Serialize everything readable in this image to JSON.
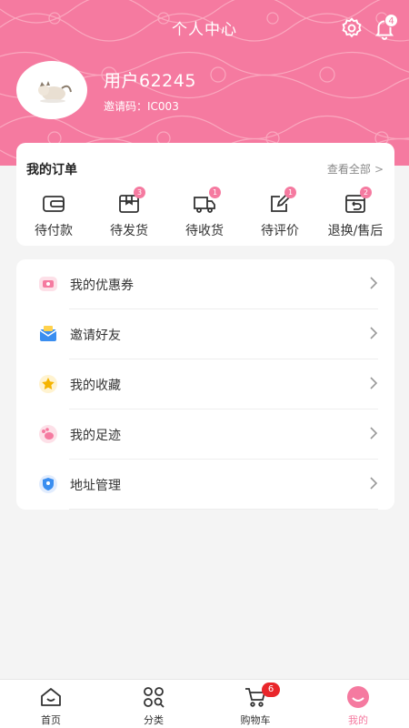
{
  "header": {
    "title": "个人中心",
    "notification_count": "4",
    "accent_color": "#f57aa0"
  },
  "profile": {
    "username": "用户62245",
    "invite_code": "邀请码：IC003"
  },
  "orders": {
    "title": "我的订单",
    "view_all": "查看全部",
    "items": [
      {
        "label": "待付款",
        "icon": "wallet-icon",
        "badge": ""
      },
      {
        "label": "待发货",
        "icon": "box-icon",
        "badge": "3"
      },
      {
        "label": "待收货",
        "icon": "truck-icon",
        "badge": "1"
      },
      {
        "label": "待评价",
        "icon": "edit-icon",
        "badge": "1"
      },
      {
        "label": "退换/售后",
        "icon": "return-icon",
        "badge": "2"
      }
    ]
  },
  "menu": {
    "items": [
      {
        "label": "我的优惠券",
        "icon": "coupon-icon"
      },
      {
        "label": "邀请好友",
        "icon": "invite-envelope-icon"
      },
      {
        "label": "我的收藏",
        "icon": "star-icon"
      },
      {
        "label": "我的足迹",
        "icon": "footprint-icon"
      },
      {
        "label": "地址管理",
        "icon": "location-shield-icon"
      }
    ]
  },
  "tabbar": {
    "items": [
      {
        "label": "首页",
        "icon": "home-icon"
      },
      {
        "label": "分类",
        "icon": "category-icon"
      },
      {
        "label": "购物车",
        "icon": "cart-icon",
        "badge": "6"
      },
      {
        "label": "我的",
        "icon": "profile-icon"
      }
    ],
    "active_index": 3
  }
}
